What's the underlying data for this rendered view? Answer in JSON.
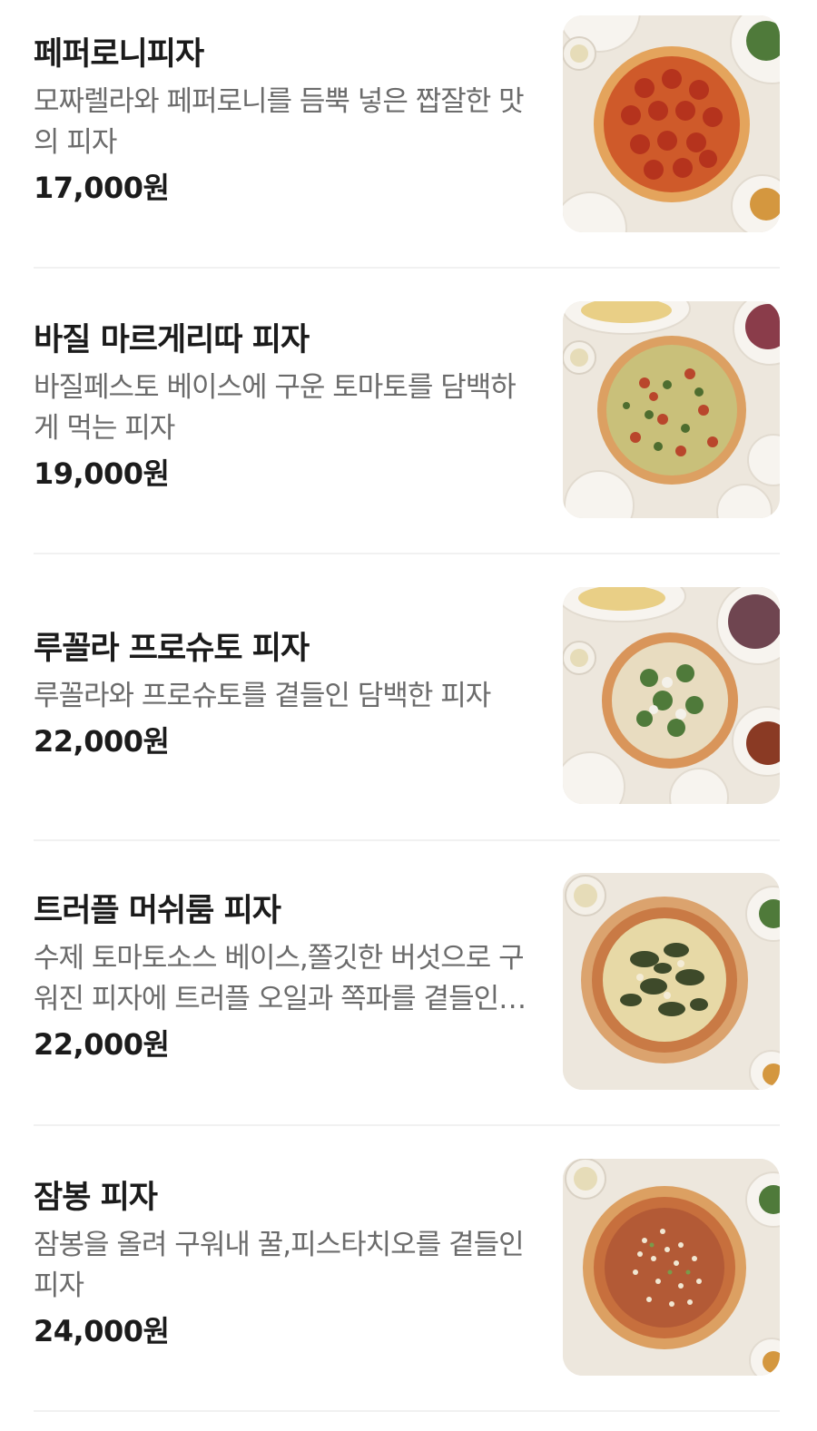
{
  "menu": {
    "items": [
      {
        "name": "페퍼로니피자",
        "description": "모짜렐라와 페퍼로니를 듬뿍 넣은 짭잘한 맛의 피자",
        "price": "17,000원",
        "photo_icon": "pepperoni-pizza-photo"
      },
      {
        "name": "바질 마르게리따 피자",
        "description": "바질페스토 베이스에 구운 토마토를 담백하게 먹는 피자",
        "price": "19,000원",
        "photo_icon": "basil-margherita-pizza-photo"
      },
      {
        "name": "루꼴라 프로슈토 피자",
        "description": "루꼴라와 프로슈토를 곁들인 담백한 피자",
        "price": "22,000원",
        "photo_icon": "arugula-prosciutto-pizza-photo"
      },
      {
        "name": "트러플 머쉬룸 피자",
        "description": "수제 토마토소스 베이스,쫄깃한 버섯으로 구워진 피자에 트러플 오일과 쪽파를 곁들인 피자",
        "price": "22,000원",
        "photo_icon": "truffle-mushroom-pizza-photo"
      },
      {
        "name": "잠봉 피자",
        "description": "잠봉을 올려 구워내 꿀,피스타치오를 곁들인 피자",
        "price": "24,000원",
        "photo_icon": "jambon-pizza-photo"
      }
    ]
  },
  "colors": {
    "title": "#1b1b1b",
    "description": "#6b6b6b",
    "divider": "#f1f1f1",
    "table": "#ece6dc"
  }
}
